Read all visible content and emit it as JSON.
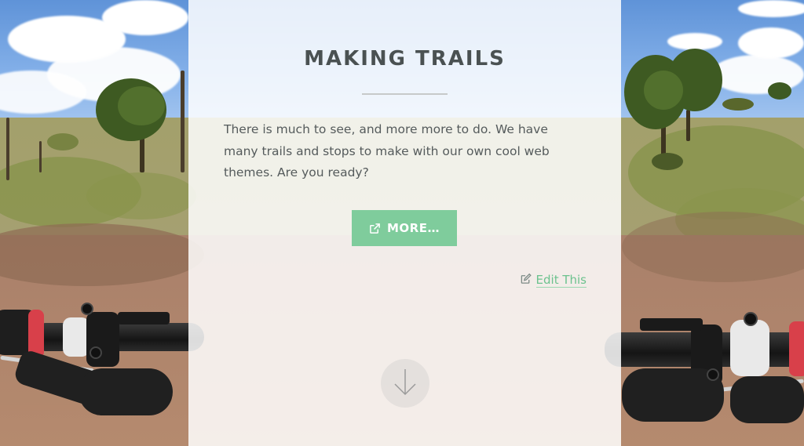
{
  "hero": {
    "title": "MAKING TRAILS",
    "body": "There is much to see, and more more to do. We have many trails and stops to make with our own cool web themes. Are you ready?",
    "button_label": "MORE…",
    "button_icon": "external-link-icon",
    "edit_label": "Edit This",
    "edit_icon": "edit-pencil-icon",
    "scroll_icon": "arrow-down-icon"
  },
  "colors": {
    "accent": "#7fcc9c",
    "link": "#6cc28e",
    "title": "#4a5152",
    "text": "#555b5c"
  }
}
